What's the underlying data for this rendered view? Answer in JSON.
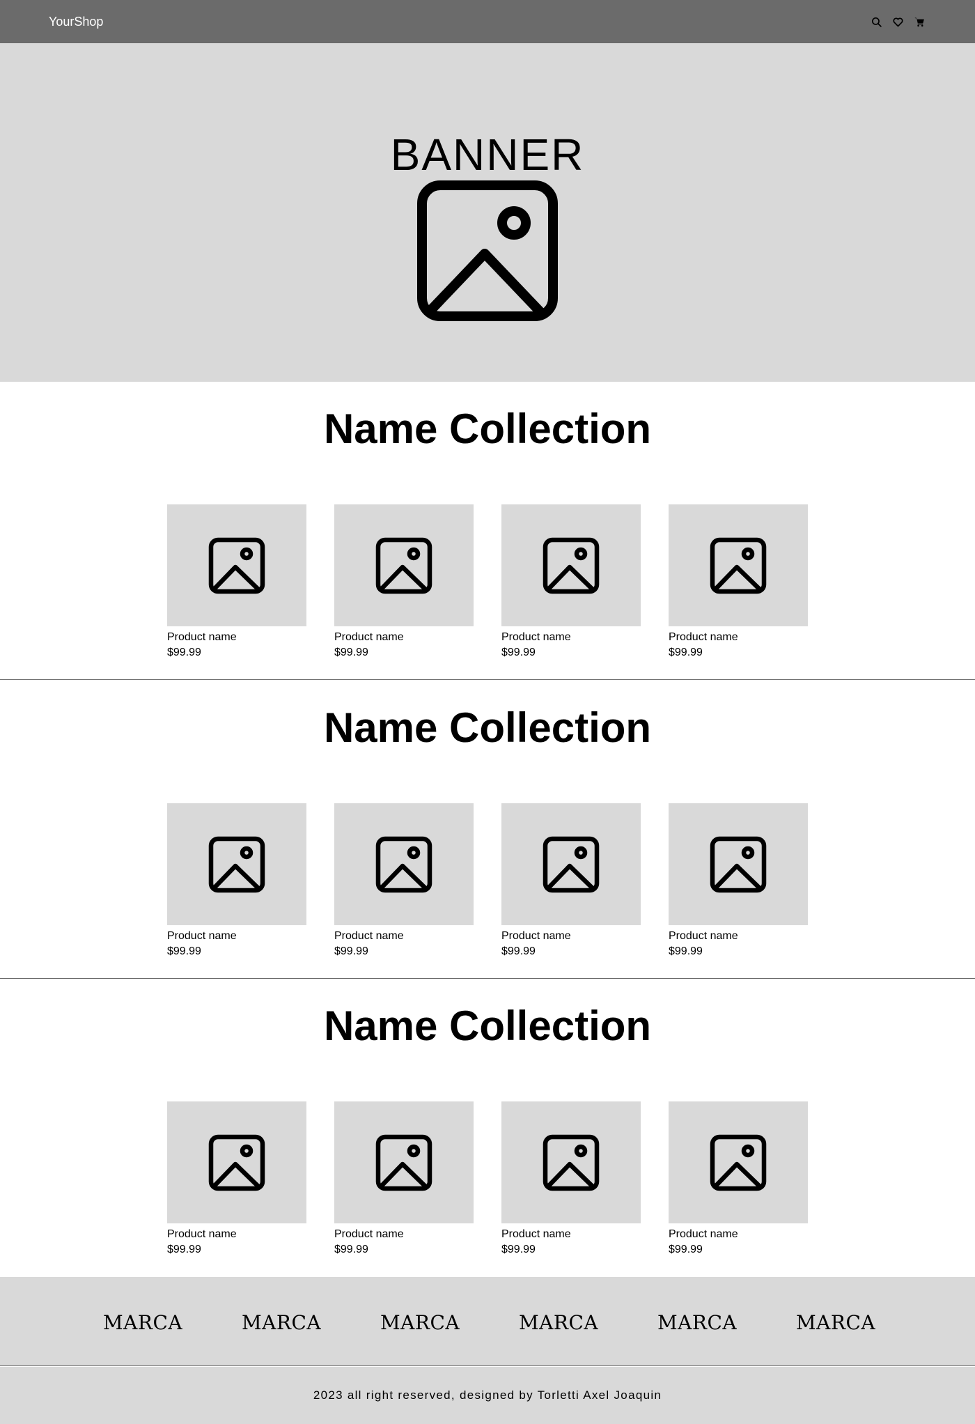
{
  "navbar": {
    "brand": "YourShop",
    "icons": [
      "search-icon",
      "heart-icon",
      "cart-icon"
    ]
  },
  "banner": {
    "title": "BANNER",
    "image_icon": "image-placeholder-icon"
  },
  "collections": [
    {
      "title": "Name Collection",
      "products": [
        {
          "name": "Product name",
          "price": "$99.99"
        },
        {
          "name": "Product name",
          "price": "$99.99"
        },
        {
          "name": "Product name",
          "price": "$99.99"
        },
        {
          "name": "Product name",
          "price": "$99.99"
        }
      ]
    },
    {
      "title": "Name Collection",
      "products": [
        {
          "name": "Product name",
          "price": "$99.99"
        },
        {
          "name": "Product name",
          "price": "$99.99"
        },
        {
          "name": "Product name",
          "price": "$99.99"
        },
        {
          "name": "Product name",
          "price": "$99.99"
        }
      ]
    },
    {
      "title": "Name Collection",
      "products": [
        {
          "name": "Product name",
          "price": "$99.99"
        },
        {
          "name": "Product name",
          "price": "$99.99"
        },
        {
          "name": "Product name",
          "price": "$99.99"
        },
        {
          "name": "Product name",
          "price": "$99.99"
        }
      ]
    }
  ],
  "brands": [
    "MARCA",
    "MARCA",
    "MARCA",
    "MARCA",
    "MARCA",
    "MARCA"
  ],
  "footer": {
    "text": "2023 all right reserved, designed by Torletti Axel Joaquin"
  },
  "colors": {
    "navbar_bg": "#6b6b6b",
    "panel_bg": "#d9d9d9",
    "page_bg": "#ffffff",
    "text": "#000000"
  }
}
